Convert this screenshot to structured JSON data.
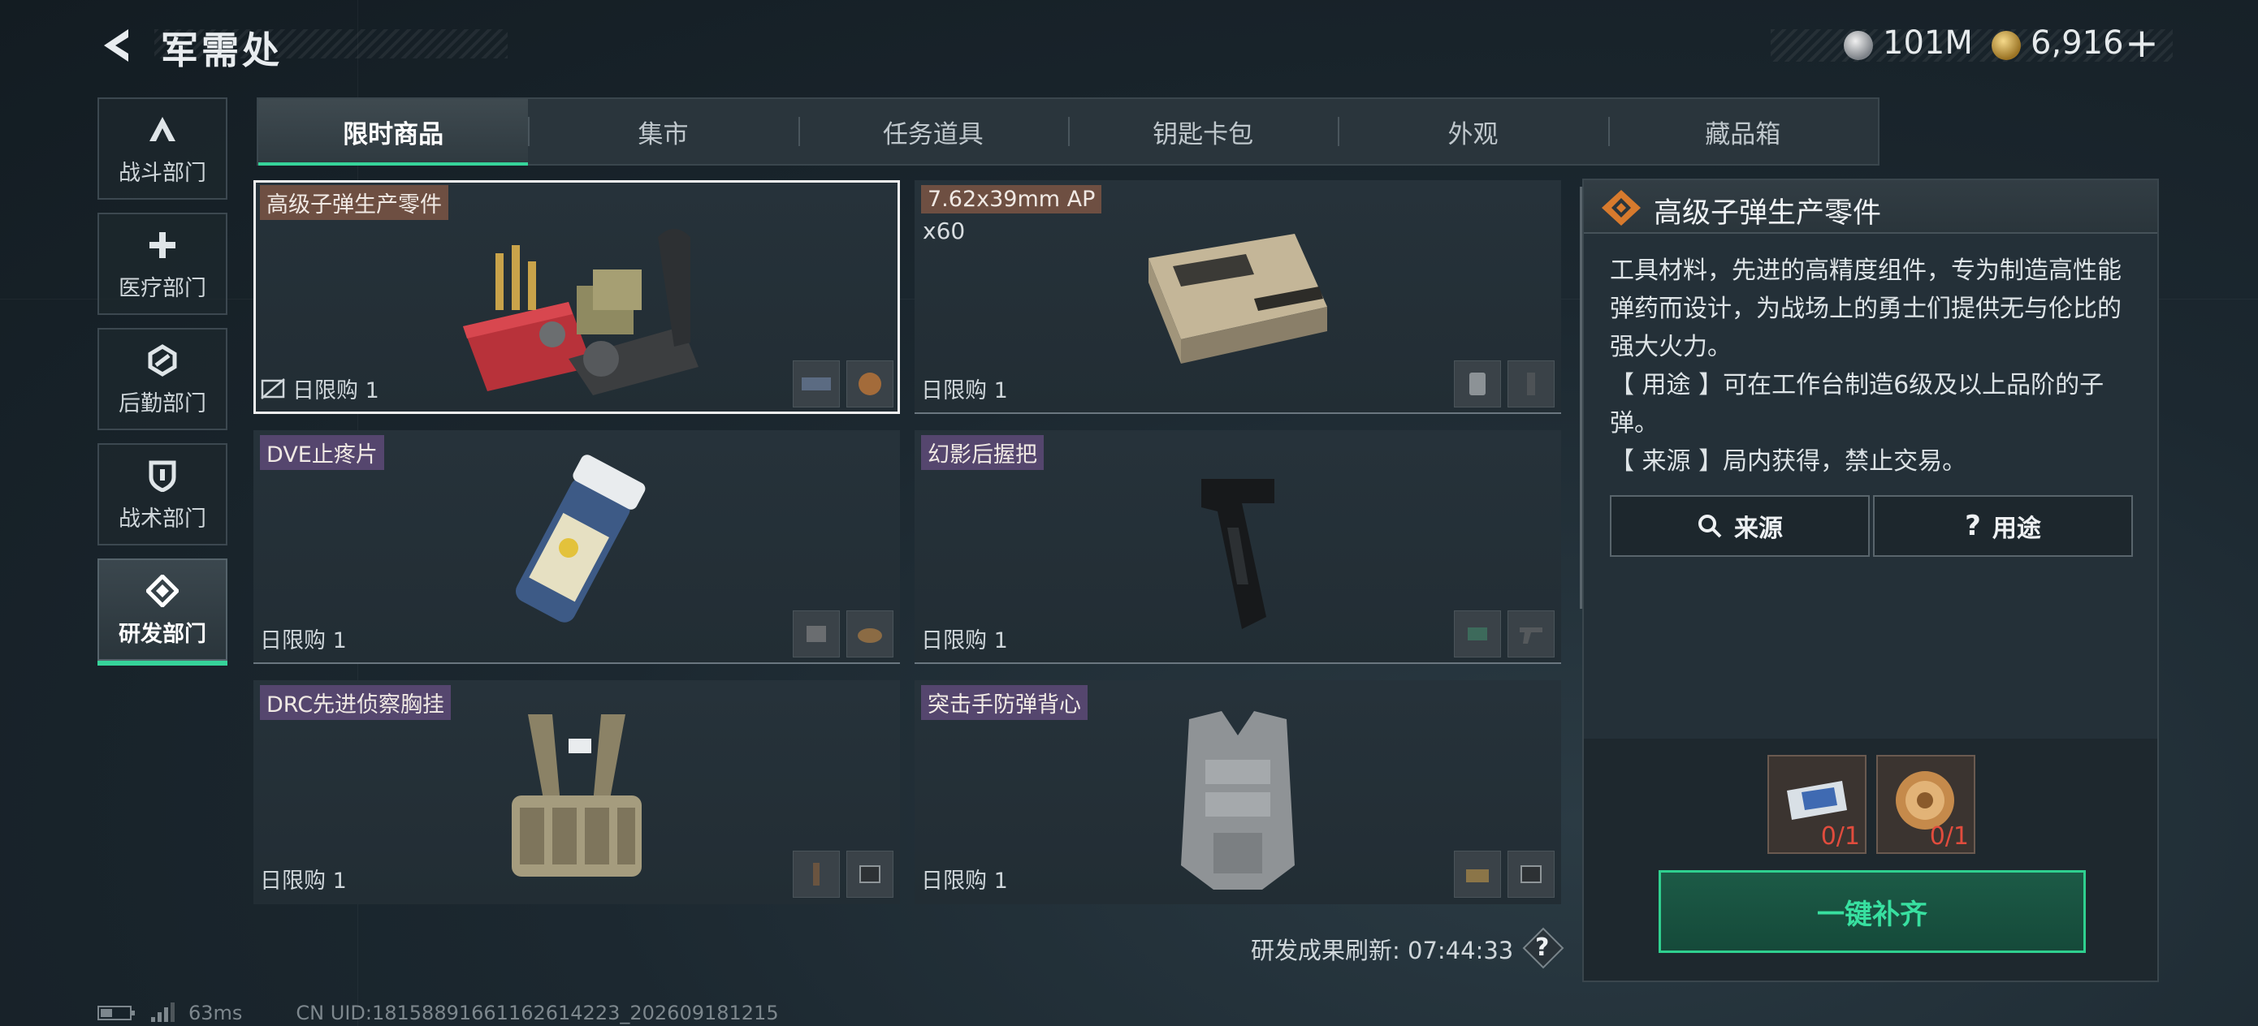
{
  "header": {
    "title": "军需处",
    "currency": [
      {
        "icon": "silver-coin-icon",
        "value": "101M"
      },
      {
        "icon": "gold-coin-icon",
        "value": "6,916"
      }
    ],
    "add_label": "+"
  },
  "sidebar": {
    "items": [
      {
        "label": "战斗部门",
        "icon": "combat-icon",
        "active": false
      },
      {
        "label": "医疗部门",
        "icon": "medical-cross-icon",
        "active": false
      },
      {
        "label": "后勤部门",
        "icon": "logistics-icon",
        "active": false
      },
      {
        "label": "战术部门",
        "icon": "tactical-shield-icon",
        "active": false
      },
      {
        "label": "研发部门",
        "icon": "research-icon",
        "active": true
      }
    ]
  },
  "tabs": [
    "限时商品",
    "集市",
    "任务道具",
    "钥匙卡包",
    "外观",
    "藏品箱"
  ],
  "active_tab": "限时商品",
  "products": [
    {
      "name": "高级子弹生产零件",
      "qty": "",
      "limit": "日限购 1",
      "tag": "brown",
      "selected": true,
      "no_trade": true
    },
    {
      "name": "7.62x39mm AP",
      "qty": "x60",
      "limit": "日限购 1",
      "tag": "brown",
      "selected": false,
      "no_trade": false
    },
    {
      "name": "DVE止疼片",
      "qty": "",
      "limit": "日限购 1",
      "tag": "purple",
      "selected": false,
      "no_trade": false
    },
    {
      "name": "幻影后握把",
      "qty": "",
      "limit": "日限购 1",
      "tag": "purple",
      "selected": false,
      "no_trade": false
    },
    {
      "name": "DRC先进侦察胸挂",
      "qty": "",
      "limit": "日限购 1",
      "tag": "purple",
      "selected": false,
      "no_trade": false
    },
    {
      "name": "突击手防弹背心",
      "qty": "",
      "limit": "日限购 1",
      "tag": "purple",
      "selected": false,
      "no_trade": false
    }
  ],
  "detail": {
    "title": "高级子弹生产零件",
    "description": [
      "工具材料，先进的高精度组件，专为制造高性能弹药而设计，为战场上的勇士们提供无与伦比的强大火力。",
      "【 用途 】可在工作台制造6级及以上品阶的子弹。",
      "【 来源 】局内获得，禁止交易。"
    ],
    "source_btn": "来源",
    "usage_btn": "用途",
    "requirements": [
      {
        "icon": "ticket-item-icon",
        "count": "0/1"
      },
      {
        "icon": "medal-item-icon",
        "count": "0/1"
      }
    ],
    "fill_btn": "一键补齐"
  },
  "refresh": {
    "label": "研发成果刷新:",
    "time": "07:44:33",
    "help": "?"
  },
  "status": {
    "ping": "63ms",
    "uid": "CN UID:18158891661162614223_202609181215"
  },
  "colors": {
    "accent_green": "#36d39a",
    "tag_brown": "#6e4f42",
    "tag_purple": "#55466e",
    "missing_red": "#e14c3d"
  }
}
